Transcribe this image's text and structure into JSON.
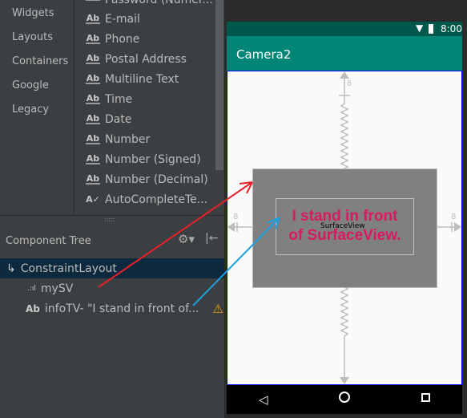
{
  "palette": {
    "categories": [
      "Widgets",
      "Layouts",
      "Containers",
      "Google",
      "Legacy"
    ],
    "items": [
      "Password (Numer...",
      "E-mail",
      "Phone",
      "Postal Address",
      "Multiline Text",
      "Time",
      "Date",
      "Number",
      "Number (Signed)",
      "Number (Decimal)",
      "AutoCompleteTe..."
    ],
    "item_icon": "Ab"
  },
  "component_tree": {
    "title": "Component Tree",
    "nodes": [
      {
        "label": "ConstraintLayout",
        "icon": "constraint-layout-icon"
      },
      {
        "label": "mySV",
        "icon": "surfaceview-icon"
      },
      {
        "label": "infoTV- \"I stand in front of...",
        "icon": "Ab"
      }
    ]
  },
  "device": {
    "time": "8:00",
    "app_title": "Camera2",
    "surface_label": "SurfaceView",
    "text_line1": "I stand in front",
    "text_line2": "of SurfaceView.",
    "margin": "8",
    "text_color": "#d81b60",
    "appbar_color": "#008577"
  }
}
